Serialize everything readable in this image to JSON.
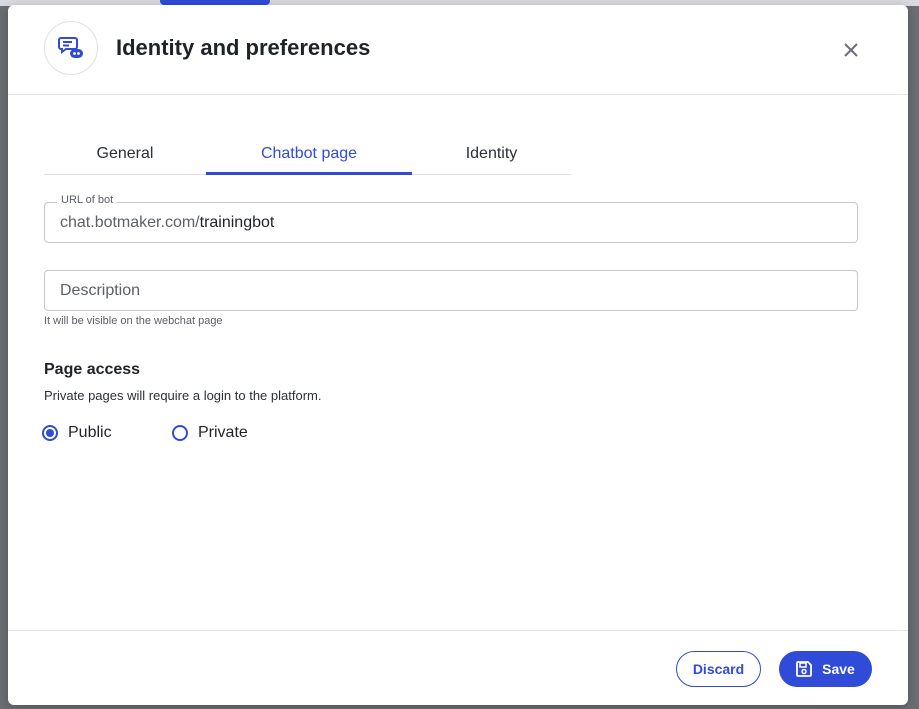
{
  "modal": {
    "title": "Identity and preferences",
    "icon": "chat-bot-icon"
  },
  "tabs": [
    {
      "label": "General",
      "active": false
    },
    {
      "label": "Chatbot page",
      "active": true
    },
    {
      "label": "Identity",
      "active": false
    }
  ],
  "url_field": {
    "label": "URL of bot",
    "prefix": "chat.botmaker.com/",
    "value": "trainingbot"
  },
  "description_field": {
    "placeholder": "Description",
    "value": "",
    "helper": "It will be visible on the webchat page"
  },
  "page_access": {
    "title": "Page access",
    "subtitle": "Private pages will require a login to the platform.",
    "options": [
      {
        "label": "Public",
        "selected": true
      },
      {
        "label": "Private",
        "selected": false
      }
    ]
  },
  "footer": {
    "discard_label": "Discard",
    "save_label": "Save"
  },
  "colors": {
    "accent": "#2f4bd8",
    "text": "#1f2329",
    "muted": "#5c6068",
    "border": "#c4c7cc"
  }
}
